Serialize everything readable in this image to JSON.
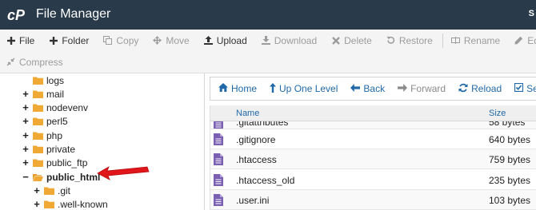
{
  "header": {
    "logo_text": "cP",
    "title": "File Manager",
    "right_cut": "S"
  },
  "toolbar": {
    "row1": [
      {
        "label": "File",
        "icon": "plus-icon",
        "enabled": true
      },
      {
        "label": "Folder",
        "icon": "plus-icon",
        "enabled": true
      },
      {
        "label": "Copy",
        "icon": "copy-icon",
        "enabled": false
      },
      {
        "label": "Move",
        "icon": "move-icon",
        "enabled": false
      },
      {
        "label": "Upload",
        "icon": "upload-icon",
        "enabled": true
      },
      {
        "label": "Download",
        "icon": "download-icon",
        "enabled": false
      },
      {
        "label": "Delete",
        "icon": "delete-icon",
        "enabled": false
      },
      {
        "label": "Restore",
        "icon": "restore-icon",
        "enabled": false
      },
      {
        "label": "Rename",
        "icon": "rename-icon",
        "enabled": false
      },
      {
        "label": "Edit",
        "icon": "edit-icon",
        "enabled": false
      }
    ],
    "row2": [
      {
        "label": "Compress",
        "icon": "compress-icon",
        "enabled": false
      }
    ]
  },
  "tree": {
    "items": [
      {
        "label": "logs",
        "toggle": "",
        "level": 0
      },
      {
        "label": "mail",
        "toggle": "+",
        "level": 0
      },
      {
        "label": "nodevenv",
        "toggle": "+",
        "level": 0
      },
      {
        "label": "perl5",
        "toggle": "+",
        "level": 0
      },
      {
        "label": "php",
        "toggle": "+",
        "level": 0
      },
      {
        "label": "private",
        "toggle": "+",
        "level": 0
      },
      {
        "label": "public_ftp",
        "toggle": "+",
        "level": 0
      },
      {
        "label": "public_html",
        "toggle": "−",
        "level": 0,
        "selected": true,
        "open": true
      },
      {
        "label": ".git",
        "toggle": "+",
        "level": 1
      },
      {
        "label": ".well-known",
        "toggle": "+",
        "level": 1
      }
    ]
  },
  "nav": {
    "buttons": [
      {
        "label": "Home",
        "icon": "home-icon",
        "enabled": true
      },
      {
        "label": "Up One Level",
        "icon": "up-arrow-icon",
        "enabled": true
      },
      {
        "label": "Back",
        "icon": "back-arrow-icon",
        "enabled": true
      },
      {
        "label": "Forward",
        "icon": "forward-arrow-icon",
        "enabled": false
      },
      {
        "label": "Reload",
        "icon": "reload-icon",
        "enabled": true
      },
      {
        "label": "Sele",
        "icon": "select-all-icon",
        "enabled": true
      }
    ]
  },
  "files": {
    "columns": {
      "name": "Name",
      "size": "Size"
    },
    "rows": [
      {
        "name": ".gitattributes",
        "size": "58 bytes"
      },
      {
        "name": ".gitignore",
        "size": "640 bytes"
      },
      {
        "name": ".htaccess",
        "size": "759 bytes"
      },
      {
        "name": ".htaccess_old",
        "size": "235 bytes"
      },
      {
        "name": ".user.ini",
        "size": "103 bytes"
      }
    ]
  },
  "colors": {
    "header_bg": "#293a4a",
    "link": "#2168a8",
    "folder": "#f0a935",
    "file_icon": "#7b5fb3",
    "annotation_arrow": "#e0161a"
  }
}
